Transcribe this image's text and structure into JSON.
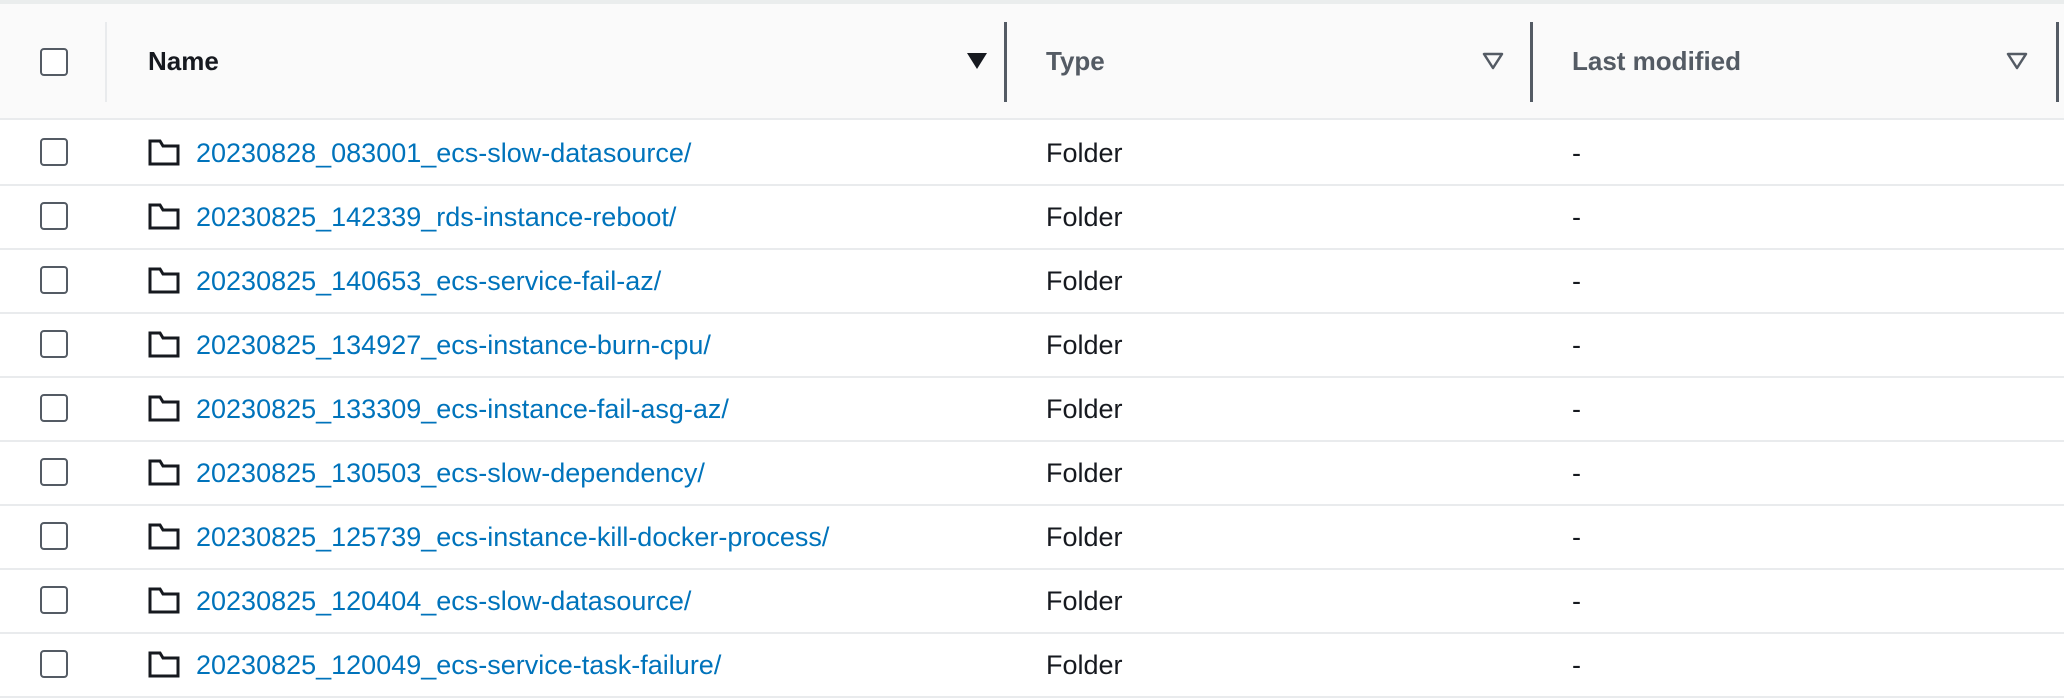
{
  "columns": {
    "name": {
      "label": "Name",
      "sort": "sorted-descending"
    },
    "type": {
      "label": "Type",
      "sort": "unsorted"
    },
    "last_modified": {
      "label": "Last modified",
      "sort": "unsorted"
    }
  },
  "rows": [
    {
      "name": "20230828_083001_ecs-slow-datasource/",
      "type": "Folder",
      "last_modified": "-",
      "icon": "folder-icon"
    },
    {
      "name": "20230825_142339_rds-instance-reboot/",
      "type": "Folder",
      "last_modified": "-",
      "icon": "folder-icon"
    },
    {
      "name": "20230825_140653_ecs-service-fail-az/",
      "type": "Folder",
      "last_modified": "-",
      "icon": "folder-icon"
    },
    {
      "name": "20230825_134927_ecs-instance-burn-cpu/",
      "type": "Folder",
      "last_modified": "-",
      "icon": "folder-icon"
    },
    {
      "name": "20230825_133309_ecs-instance-fail-asg-az/",
      "type": "Folder",
      "last_modified": "-",
      "icon": "folder-icon"
    },
    {
      "name": "20230825_130503_ecs-slow-dependency/",
      "type": "Folder",
      "last_modified": "-",
      "icon": "folder-icon"
    },
    {
      "name": "20230825_125739_ecs-instance-kill-docker-process/",
      "type": "Folder",
      "last_modified": "-",
      "icon": "folder-icon"
    },
    {
      "name": "20230825_120404_ecs-slow-datasource/",
      "type": "Folder",
      "last_modified": "-",
      "icon": "folder-icon"
    },
    {
      "name": "20230825_120049_ecs-service-task-failure/",
      "type": "Folder",
      "last_modified": "-",
      "icon": "folder-icon"
    }
  ],
  "colors": {
    "link": "#0073bb",
    "text": "#16191f",
    "header_bg": "#fafafa",
    "border": "#e9ebed"
  }
}
